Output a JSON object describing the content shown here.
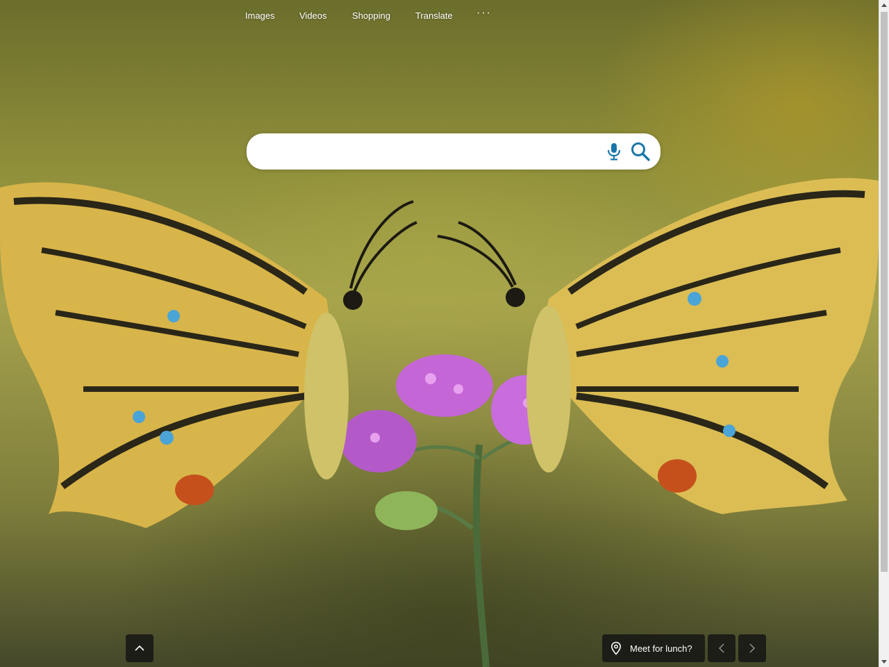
{
  "nav": {
    "items": [
      {
        "label": "Images"
      },
      {
        "label": "Videos"
      },
      {
        "label": "Shopping"
      },
      {
        "label": "Translate"
      }
    ],
    "more_label": "···"
  },
  "search": {
    "placeholder": "",
    "value": "",
    "mic_icon": "microphone-icon",
    "search_icon": "search-icon",
    "accent_color": "#1a76a9"
  },
  "background": {
    "subject": "swallowtail-butterflies-on-flower-photo"
  },
  "bottom": {
    "scroll_up_icon": "chevron-up-icon",
    "caption": "Meet for lunch?",
    "location_icon": "location-pin-icon",
    "prev_icon": "chevron-left-icon",
    "next_icon": "chevron-right-icon"
  }
}
